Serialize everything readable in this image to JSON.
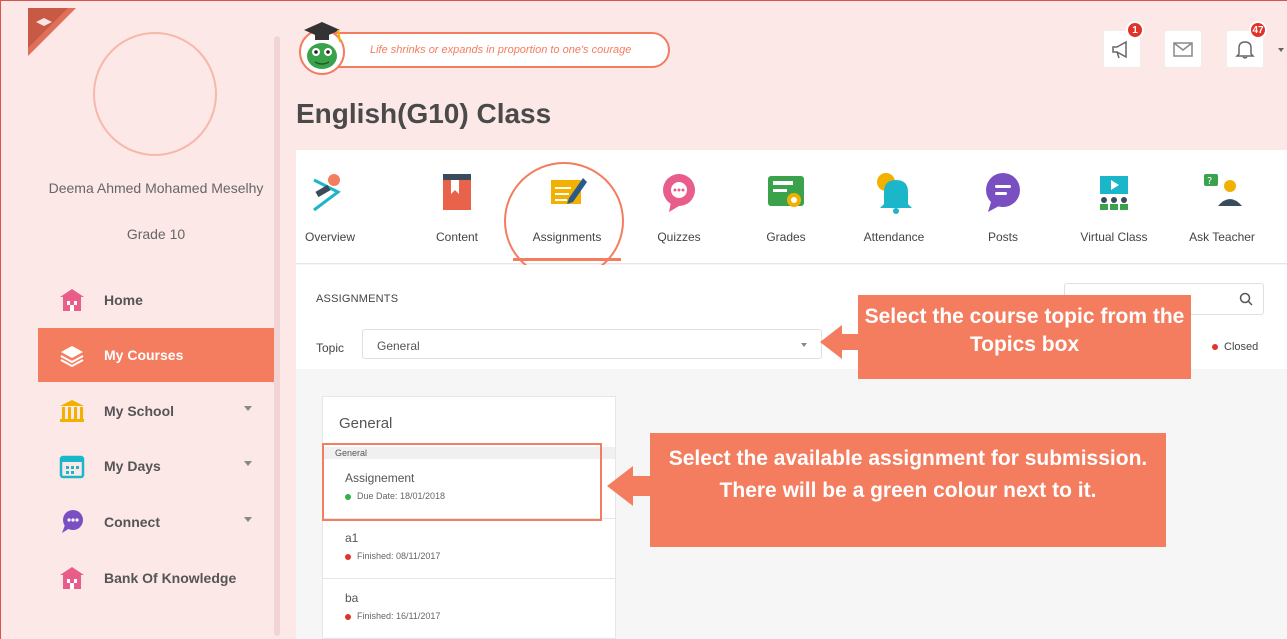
{
  "user": {
    "name": "Deema Ahmed Mohamed Meselhy",
    "grade": "Grade 10"
  },
  "sidebar": {
    "items": [
      {
        "label": "Home",
        "icon": "home-icon"
      },
      {
        "label": "My Courses",
        "icon": "layers-icon",
        "active": true
      },
      {
        "label": "My School",
        "icon": "school-icon",
        "caret": true
      },
      {
        "label": "My Days",
        "icon": "calendar-icon",
        "caret": true
      },
      {
        "label": "Connect",
        "icon": "chat-icon",
        "caret": true
      },
      {
        "label": "Bank Of Knowledge",
        "icon": "bank-icon"
      }
    ]
  },
  "header": {
    "quote": "Life shrinks or expands in proportion to one's courage",
    "announcements_badge": "1",
    "notifications_badge": "47"
  },
  "page": {
    "title": "English(G10) Class"
  },
  "tabs": [
    {
      "label": "Overview",
      "icon": "overview-icon"
    },
    {
      "label": "Content",
      "icon": "book-icon"
    },
    {
      "label": "Assignments",
      "icon": "assignment-icon",
      "active": true
    },
    {
      "label": "Quizzes",
      "icon": "quiz-icon"
    },
    {
      "label": "Grades",
      "icon": "grades-icon"
    },
    {
      "label": "Attendance",
      "icon": "bell-icon"
    },
    {
      "label": "Posts",
      "icon": "posts-icon"
    },
    {
      "label": "Virtual Class",
      "icon": "virtual-class-icon"
    },
    {
      "label": "Ask Teacher",
      "icon": "ask-teacher-icon"
    }
  ],
  "assignments": {
    "section_title": "ASSIGNMENTS",
    "topic_label": "Topic",
    "topic_value": "General",
    "closed_legend": "Closed",
    "card_title": "General",
    "group_label": "General",
    "items": [
      {
        "name": "Assignement",
        "date": "Due Date: 18/01/2018",
        "status_color": "#2fb344"
      },
      {
        "name": "a1",
        "date": "Finished: 08/11/2017",
        "status_color": "#e0342a"
      },
      {
        "name": "ba",
        "date": "Finished: 16/11/2017",
        "status_color": "#e0342a"
      }
    ]
  },
  "callouts": {
    "topic": "Select the course topic from the Topics box",
    "assignment": "Select the available assignment for submission. There will be a green colour next to it."
  },
  "colors": {
    "accent": "#f47c5f",
    "background": "#fde8e8",
    "open": "#2fb344",
    "closed": "#e0342a"
  }
}
